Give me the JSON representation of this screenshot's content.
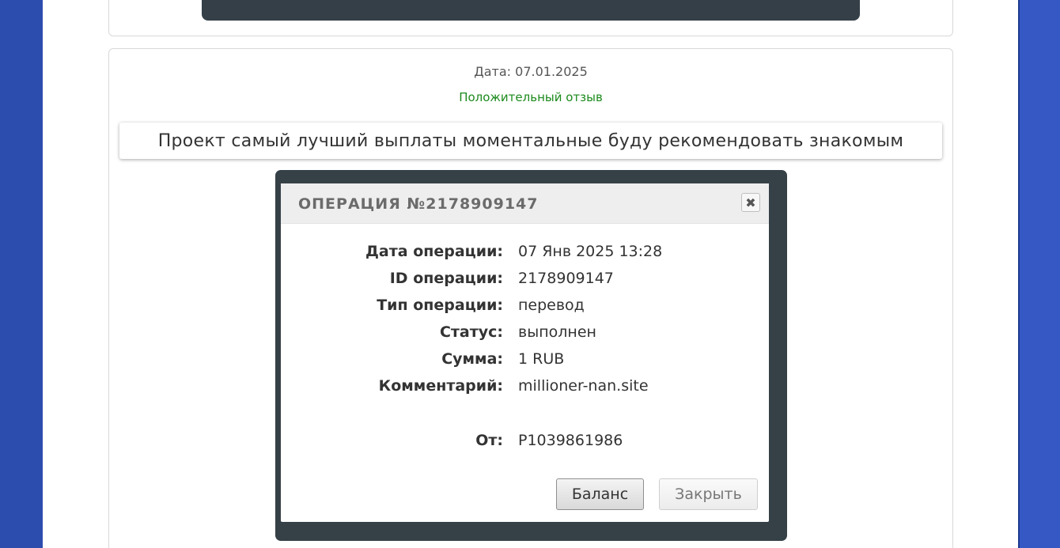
{
  "review": {
    "date_label": "Дата: 07.01.2025",
    "type_label": "Положительный отзыв",
    "text": "Проект самый лучший выплаты моментальные буду рекомендовать знакомым"
  },
  "dialog": {
    "title": "ОПЕРАЦИЯ №2178909147",
    "close_icon": "close-icon",
    "fields": [
      {
        "label": "Дата операции:",
        "value": "07 Янв 2025 13:28"
      },
      {
        "label": "ID операции:",
        "value": "2178909147"
      },
      {
        "label": "Тип операции:",
        "value": "перевод"
      },
      {
        "label": "Статус:",
        "value": "выполнен"
      },
      {
        "label": "Сумма:",
        "value": "1 RUB"
      },
      {
        "label": "Комментарий:",
        "value": "millioner-nan.site"
      },
      {
        "label": "От:",
        "value": "P1039861986"
      }
    ],
    "buttons": {
      "balance": "Баланс",
      "close": "Закрыть"
    }
  }
}
